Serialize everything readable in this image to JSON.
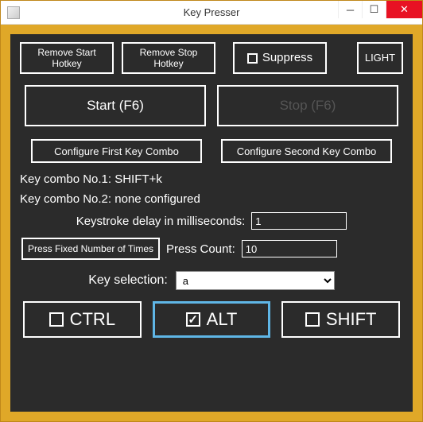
{
  "window": {
    "title": "Key Presser"
  },
  "top": {
    "remove_start": "Remove Start\nHotkey",
    "remove_stop": "Remove Stop\nHotkey",
    "suppress_label": "Suppress",
    "light": "LIGHT"
  },
  "control": {
    "start_label": "Start (F6)",
    "stop_label": "Stop (F6)"
  },
  "configure": {
    "first": "Configure First Key Combo",
    "second": "Configure Second Key Combo"
  },
  "combo": {
    "line1": "Key combo No.1: SHIFT+k",
    "line2": "Key combo No.2: none configured"
  },
  "delay": {
    "label": "Keystroke delay in milliseconds:",
    "value": "1"
  },
  "press": {
    "fixed_label": "Press Fixed Number of Times",
    "count_label": "Press Count:",
    "count_value": "10"
  },
  "keysel": {
    "label": "Key selection:",
    "value": "a"
  },
  "mods": {
    "ctrl": "CTRL",
    "alt": "ALT",
    "shift": "SHIFT"
  }
}
